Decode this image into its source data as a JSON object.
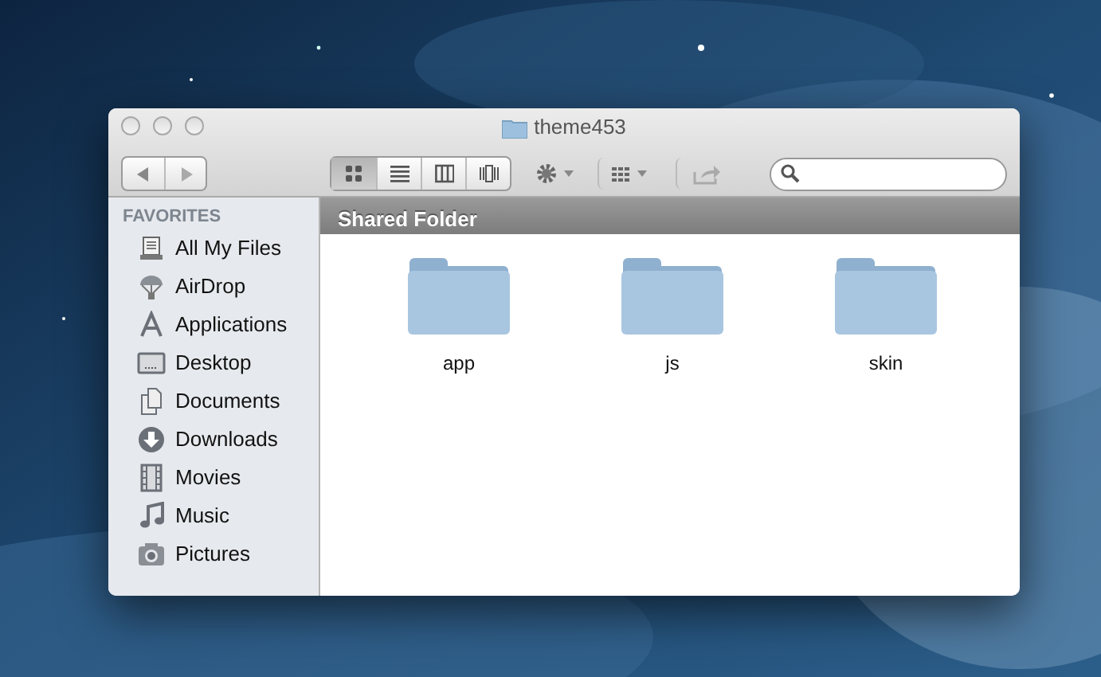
{
  "window": {
    "title": "theme453"
  },
  "view_buttons": [
    {
      "selected": true
    },
    {
      "selected": false
    },
    {
      "selected": false
    },
    {
      "selected": false
    }
  ],
  "sidebar": {
    "heading": "FAVORITES",
    "items": [
      {
        "label": "All My Files"
      },
      {
        "label": "AirDrop"
      },
      {
        "label": "Applications"
      },
      {
        "label": "Desktop"
      },
      {
        "label": "Documents"
      },
      {
        "label": "Downloads"
      },
      {
        "label": "Movies"
      },
      {
        "label": "Music"
      },
      {
        "label": "Pictures"
      }
    ]
  },
  "path_bar": {
    "title": "Shared Folder"
  },
  "folders": [
    {
      "name": "app"
    },
    {
      "name": "js"
    },
    {
      "name": "skin"
    }
  ]
}
